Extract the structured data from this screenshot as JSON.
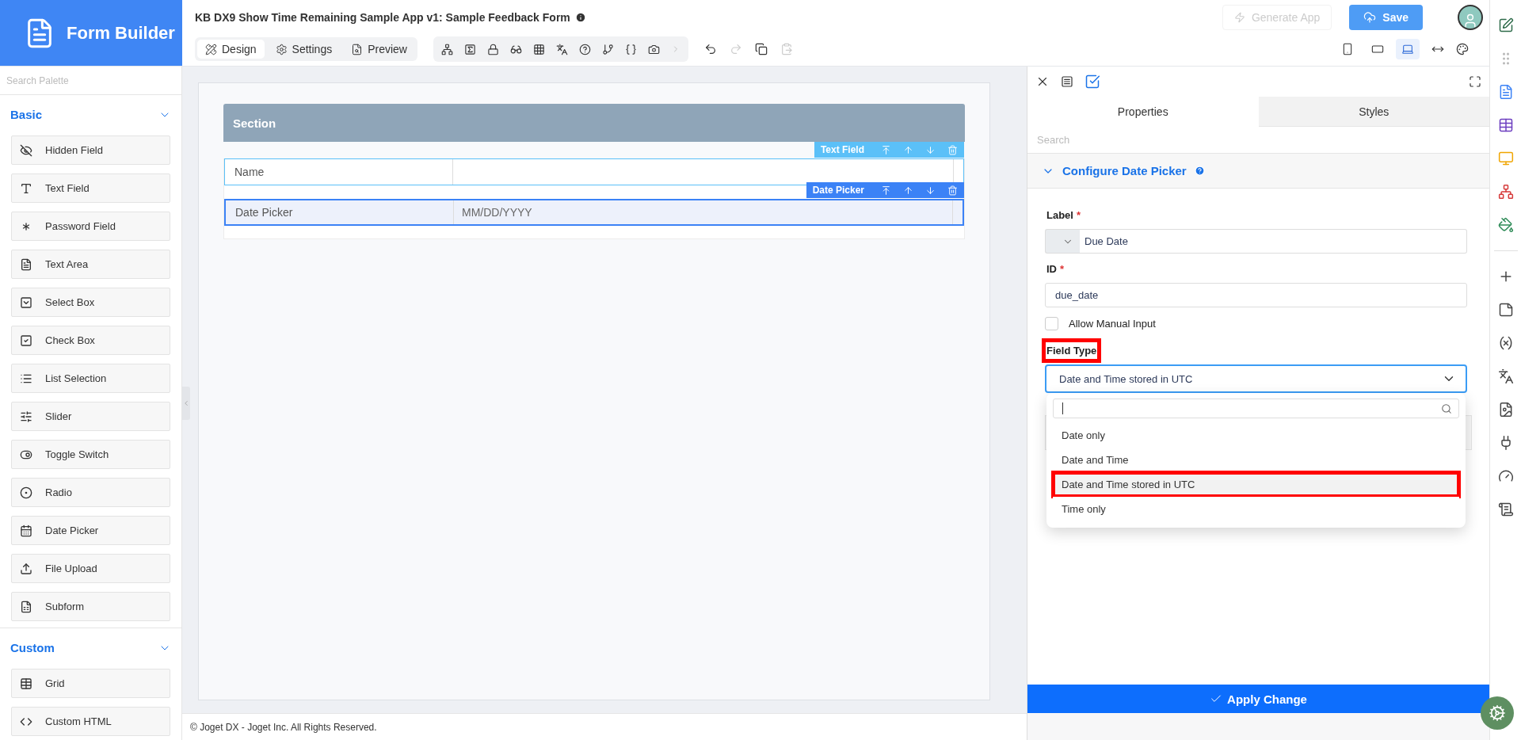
{
  "brand": {
    "title": "Form Builder"
  },
  "header": {
    "title": "KB DX9 Show Time Remaining Sample App v1: Sample Feedback Form",
    "generate_button": {
      "label": "Generate App",
      "disabled": true
    },
    "save_button": {
      "label": "Save"
    }
  },
  "mode_tabs": [
    {
      "label": "Design",
      "selected": true
    },
    {
      "label": "Settings",
      "selected": false
    },
    {
      "label": "Preview",
      "selected": false
    }
  ],
  "device_buttons": [
    {
      "selected": false
    },
    {
      "selected": false
    },
    {
      "selected": true
    },
    {
      "selected": false
    }
  ],
  "palette": {
    "search_placeholder": "Search Palette",
    "groups": [
      {
        "title": "Basic",
        "expanded": true,
        "items": [
          "Hidden Field",
          "Text Field",
          "Password Field",
          "Text Area",
          "Select Box",
          "Check Box",
          "List Selection",
          "Slider",
          "Toggle Switch",
          "Radio",
          "Date Picker",
          "File Upload",
          "Subform"
        ]
      },
      {
        "title": "Custom",
        "expanded": true,
        "items": [
          "Grid",
          "Custom HTML"
        ]
      }
    ]
  },
  "canvas": {
    "section_title": "Section",
    "fields": [
      {
        "label": "Name",
        "type_label": "Text Field",
        "selected": false
      },
      {
        "label": "Date Picker",
        "type_label": "Date Picker",
        "placeholder": "MM/DD/YYYY",
        "selected": true
      }
    ]
  },
  "footer": "© Joget DX - Joget Inc. All Rights Reserved.",
  "properties": {
    "tabs": [
      {
        "label": "Properties",
        "selected": true
      },
      {
        "label": "Styles",
        "selected": false
      }
    ],
    "search_placeholder": "Search",
    "section": {
      "title": "Configure Date Picker",
      "expanded": true
    },
    "label_field": {
      "label": "Label",
      "required_mark": "*",
      "value": "Due Date"
    },
    "id_field": {
      "label": "ID",
      "required_mark": "*",
      "value": "due_date"
    },
    "allow_manual_input": {
      "label": "Allow Manual Input",
      "checked": false
    },
    "field_type": {
      "label": "Field Type",
      "highlighted": true,
      "value": "Date and Time stored in UTC",
      "open": true,
      "options": [
        {
          "label": "Date only",
          "selected": false,
          "highlighted": false
        },
        {
          "label": "Date and Time",
          "selected": false,
          "highlighted": false
        },
        {
          "label": "Date and Time stored in UTC",
          "selected": true,
          "highlighted": true
        },
        {
          "label": "Time only",
          "selected": false,
          "highlighted": false
        }
      ]
    },
    "apply_button": "Apply Change"
  }
}
